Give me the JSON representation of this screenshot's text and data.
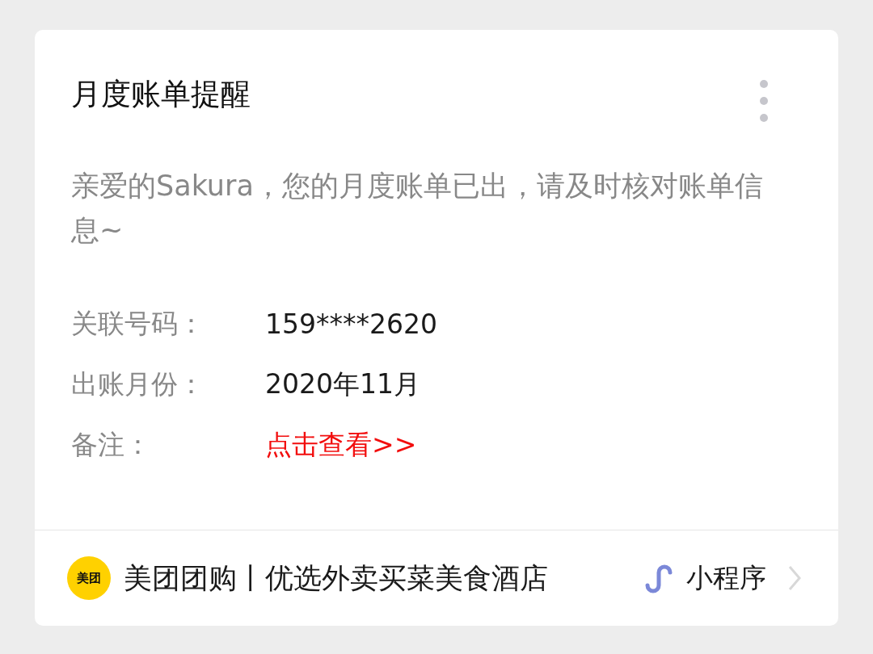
{
  "card": {
    "title": "月度账单提醒",
    "message": "亲爱的Sakura，您的月度账单已出，请及时核对账单信息~",
    "fields": [
      {
        "label": "关联号码：",
        "value": "159****2620",
        "kind": "text"
      },
      {
        "label": "出账月份：",
        "value": "2020年11月",
        "kind": "text"
      },
      {
        "label": "备注：",
        "value": "点击查看>>",
        "kind": "link"
      }
    ]
  },
  "footer": {
    "logo_text": "美团",
    "app_name": "美团团购丨优选外卖买菜美食酒店",
    "badge": "小程序"
  }
}
